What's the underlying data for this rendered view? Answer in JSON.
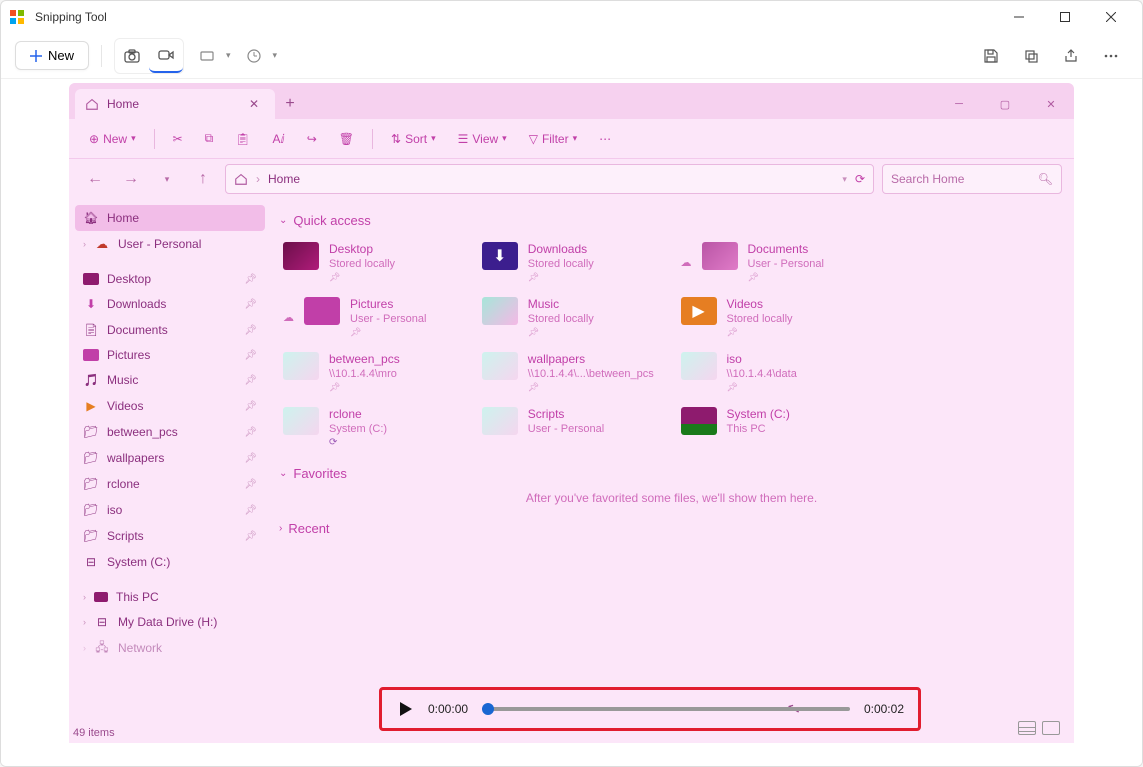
{
  "app": {
    "title": "Snipping Tool",
    "new_label": "New"
  },
  "explorer": {
    "tab_title": "Home",
    "cmdbar": {
      "new": "New",
      "sort": "Sort",
      "view": "View",
      "filter": "Filter"
    },
    "nav": {
      "breadcrumb": "Home",
      "search_placeholder": "Search Home"
    },
    "sidebar": {
      "home": "Home",
      "user_personal": "User - Personal",
      "desktop": "Desktop",
      "downloads": "Downloads",
      "documents": "Documents",
      "pictures": "Pictures",
      "music": "Music",
      "videos": "Videos",
      "between_pcs": "between_pcs",
      "wallpapers": "wallpapers",
      "rclone": "rclone",
      "iso": "iso",
      "scripts": "Scripts",
      "system_c": "System (C:)",
      "this_pc": "This PC",
      "my_data_drive": "My Data Drive (H:)",
      "network": "Network"
    },
    "sections": {
      "quick_access": "Quick access",
      "favorites": "Favorites",
      "recent": "Recent",
      "fav_empty": "After you've favorited some files, we'll show them here."
    },
    "quick_access_items": {
      "desktop": {
        "name": "Desktop",
        "sub": "Stored locally"
      },
      "downloads": {
        "name": "Downloads",
        "sub": "Stored locally"
      },
      "documents": {
        "name": "Documents",
        "sub": "User - Personal"
      },
      "pictures": {
        "name": "Pictures",
        "sub": "User - Personal"
      },
      "music": {
        "name": "Music",
        "sub": "Stored locally"
      },
      "videos": {
        "name": "Videos",
        "sub": "Stored locally"
      },
      "between_pcs": {
        "name": "between_pcs",
        "sub": "\\\\10.1.4.4\\mro"
      },
      "wallpapers": {
        "name": "wallpapers",
        "sub": "\\\\10.1.4.4\\...\\between_pcs"
      },
      "iso": {
        "name": "iso",
        "sub": "\\\\10.1.4.4\\data"
      },
      "rclone": {
        "name": "rclone",
        "sub": "System (C:)"
      },
      "scripts": {
        "name": "Scripts",
        "sub": "User - Personal"
      },
      "system_c": {
        "name": "System (C:)",
        "sub": "This PC"
      }
    },
    "status": "49 items"
  },
  "player": {
    "current": "0:00:00",
    "total": "0:00:02"
  }
}
